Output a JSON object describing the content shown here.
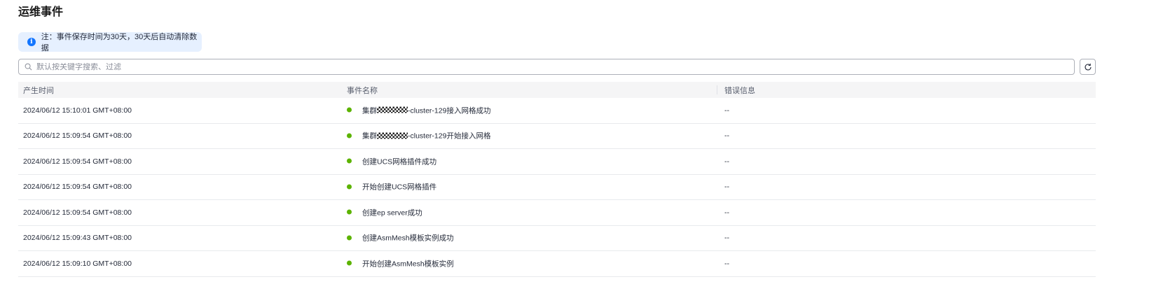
{
  "page": {
    "title": "运维事件"
  },
  "notice": {
    "icon": "info-icon",
    "text": "注：事件保存时间为30天，30天后自动清除数据"
  },
  "search": {
    "placeholder": "默认按关键字搜索、过滤",
    "value": ""
  },
  "toolbar": {
    "refresh_icon": "refresh-icon"
  },
  "table": {
    "columns": [
      "产生时间",
      "事件名称",
      "错误信息"
    ],
    "rows": [
      {
        "time": "2024/06/12 15:10:01 GMT+08:00",
        "name_prefix": "集群",
        "name_masked": true,
        "name_suffix": "-cluster-129接入网格成功",
        "error": "--",
        "status_color": "#5cb300"
      },
      {
        "time": "2024/06/12 15:09:54 GMT+08:00",
        "name_prefix": "集群",
        "name_masked": true,
        "name_suffix": "-cluster-129开始接入网格",
        "error": "--",
        "status_color": "#5cb300"
      },
      {
        "time": "2024/06/12 15:09:54 GMT+08:00",
        "name_prefix": "创建UCS网格插件成功",
        "name_masked": false,
        "name_suffix": "",
        "error": "--",
        "status_color": "#5cb300"
      },
      {
        "time": "2024/06/12 15:09:54 GMT+08:00",
        "name_prefix": "开始创建UCS网格插件",
        "name_masked": false,
        "name_suffix": "",
        "error": "--",
        "status_color": "#5cb300"
      },
      {
        "time": "2024/06/12 15:09:54 GMT+08:00",
        "name_prefix": "创建ep server成功",
        "name_masked": false,
        "name_suffix": "",
        "error": "--",
        "status_color": "#5cb300"
      },
      {
        "time": "2024/06/12 15:09:43 GMT+08:00",
        "name_prefix": "创建AsmMesh模板实例成功",
        "name_masked": false,
        "name_suffix": "",
        "error": "--",
        "status_color": "#5cb300"
      },
      {
        "time": "2024/06/12 15:09:10 GMT+08:00",
        "name_prefix": "开始创建AsmMesh模板实例",
        "name_masked": false,
        "name_suffix": "",
        "error": "--",
        "status_color": "#5cb300"
      }
    ]
  }
}
